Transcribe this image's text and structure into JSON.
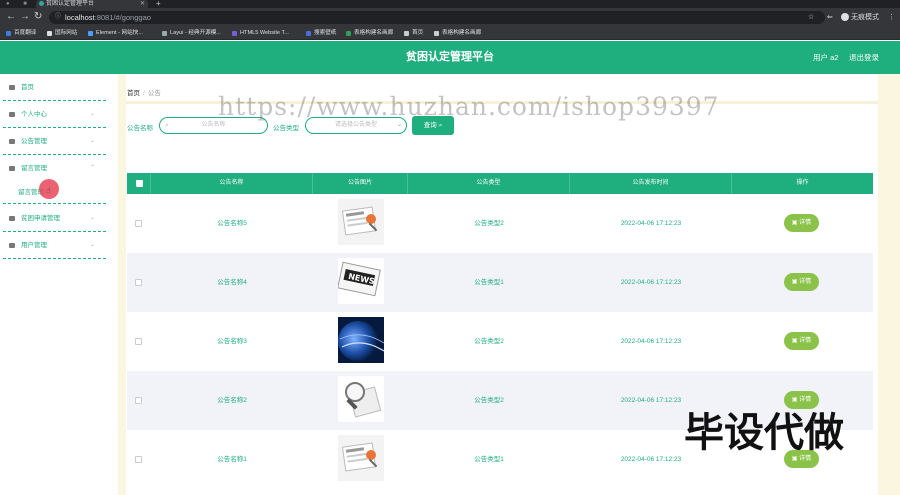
{
  "browser": {
    "tab_title": "贫困认定管理平台",
    "url_host": "localhost",
    "url_path": ":8081/#/gonggao",
    "profile_label": "无痕模式",
    "bookmarks": [
      "百度翻译",
      "国际网站",
      "Element - 网站快...",
      "Layui - 经典开源模...",
      "HTML5 Website T...",
      "搜索壁纸",
      "表格构建名画廊",
      "首页",
      "表格构建名画廊"
    ]
  },
  "header": {
    "title": "贫困认定管理平台",
    "user": "用户 a2",
    "logout": "退出登录"
  },
  "sidebar": {
    "items": [
      {
        "label": "首页"
      },
      {
        "label": "个人中心"
      },
      {
        "label": "公告管理"
      },
      {
        "label": "留言管理"
      },
      {
        "label": "留言管理"
      },
      {
        "label": "贫困申请管理"
      },
      {
        "label": "用户管理"
      }
    ]
  },
  "breadcrumb": {
    "home": "首页",
    "sep": "/",
    "current": "公告"
  },
  "search": {
    "name_label": "公告名称",
    "name_placeholder": "公告名称",
    "type_label": "公告类型",
    "type_placeholder": "请选择公告类型",
    "query_label": "查询"
  },
  "table": {
    "columns": [
      "公告名称",
      "公告图片",
      "公告类型",
      "公告发布时间",
      "操作"
    ],
    "rows": [
      {
        "name": "公告名称5",
        "type": "公告类型2",
        "time": "2022-04-06 17:12:23",
        "action": "详情"
      },
      {
        "name": "公告名称4",
        "type": "公告类型1",
        "time": "2022-04-06 17:12:23",
        "action": "详情"
      },
      {
        "name": "公告名称3",
        "type": "公告类型2",
        "time": "2022-04-06 17:12:23",
        "action": "详情"
      },
      {
        "name": "公告名称2",
        "type": "公告类型2",
        "time": "2022-04-06 17:12:23",
        "action": "详情"
      },
      {
        "name": "公告名称1",
        "type": "公告类型1",
        "time": "2022-04-06 17:12:23",
        "action": "详情"
      }
    ]
  },
  "watermarks": {
    "url": "https://www.huzhan.com/ishop39397",
    "corner": "毕设代做"
  },
  "colors": {
    "primary": "#1fae7e",
    "detail_button": "#8bc34a",
    "alt_row": "#f2f3f9"
  }
}
